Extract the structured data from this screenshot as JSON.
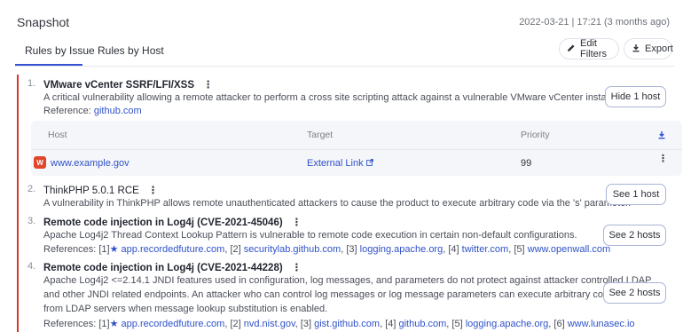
{
  "header": {
    "title": "Snapshot",
    "timestamp": "2022-03-21 | 17:21 (3 months ago)"
  },
  "tabs": [
    {
      "label": "Rules by Issue",
      "active": true
    },
    {
      "label": "Rules by Host",
      "active": false
    }
  ],
  "toolbar": {
    "edit_filters_label": "Edit Filters",
    "export_label": "Export"
  },
  "colors": {
    "accent": "#3452d1",
    "critical": "#d9362a",
    "link": "#2f52c9"
  },
  "issues": [
    {
      "number": "1.",
      "title": "VMware vCenter SSRF/LFI/XSS",
      "description": "A critical vulnerability allowing a remote attacker to perform a cross site scripting attack against a vulnerable VMware vCenter instance",
      "reference_label": "Reference:",
      "reference_link": "github.com",
      "button_label": "Hide 1 host",
      "hosts_table": {
        "columns": [
          "Host",
          "Target",
          "Priority"
        ],
        "rows": [
          {
            "host_icon_letter": "W",
            "host": "www.example.gov",
            "target": "External Link",
            "priority": "99"
          }
        ]
      }
    },
    {
      "number": "2.",
      "title": "ThinkPHP 5.0.1 RCE",
      "description": "A vulnerability in ThinkPHP allows remote unauthenticated attackers to cause the product to execute arbitrary code via the 's' parameter.",
      "button_label": "See 1 host"
    },
    {
      "number": "3.",
      "title": "Remote code injection in Log4j (CVE-2021-45046)",
      "description": "Apache Log4j2 Thread Context Lookup Pattern is vulnerable to remote code execution in certain non-default configurations.",
      "references_label": "References:",
      "references": [
        {
          "index": "[1]",
          "text": "app.recordedfuture.com",
          "starred": true
        },
        {
          "index": "[2]",
          "text": "securitylab.github.com"
        },
        {
          "index": "[3]",
          "text": "logging.apache.org"
        },
        {
          "index": "[4]",
          "text": "twitter.com"
        },
        {
          "index": "[5]",
          "text": "www.openwall.com"
        }
      ],
      "button_label": "See 2 hosts"
    },
    {
      "number": "4.",
      "title": "Remote code injection in Log4j (CVE-2021-44228)",
      "description_lines": [
        "Apache Log4j2 <=2.14.1 JNDI features used in configuration, log messages, and parameters do not protect against attacker controlled LDAP",
        "and other JNDI related endpoints. An attacker who can control log messages or log message parameters can execute arbitrary code loaded",
        "from LDAP servers when message lookup substitution is enabled."
      ],
      "references_label": "References:",
      "references": [
        {
          "index": "[1]",
          "text": "app.recordedfuture.com",
          "starred": true
        },
        {
          "index": "[2]",
          "text": "nvd.nist.gov"
        },
        {
          "index": "[3]",
          "text": "gist.github.com"
        },
        {
          "index": "[4]",
          "text": "github.com"
        },
        {
          "index": "[5]",
          "text": "logging.apache.org"
        },
        {
          "index": "[6]",
          "text": "www.lunasec.io"
        }
      ],
      "button_label": "See 2 hosts"
    }
  ]
}
